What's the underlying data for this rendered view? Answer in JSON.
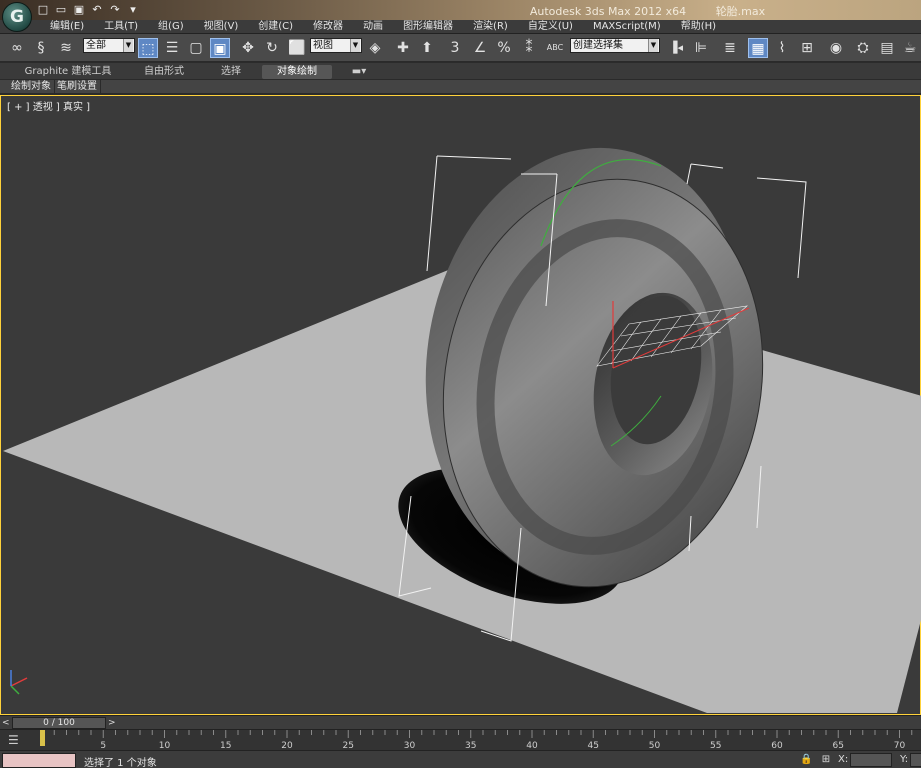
{
  "window": {
    "app_title": "Autodesk 3ds Max  2012 x64",
    "file_name": "轮胎.max",
    "logo_glyph": "G"
  },
  "quick_access": {
    "icons": [
      "new-file-icon",
      "open-file-icon",
      "save-icon",
      "undo-icon",
      "redo-icon",
      "customize-icon"
    ],
    "glyphs": [
      "□",
      "▭",
      "▣",
      "↶",
      "↷",
      "▾"
    ]
  },
  "menus": [
    "编辑(E)",
    "工具(T)",
    "组(G)",
    "视图(V)",
    "创建(C)",
    "修改器",
    "动画",
    "图形编辑器",
    "渲染(R)",
    "自定义(U)",
    "MAXScript(M)",
    "帮助(H)"
  ],
  "toolbar": {
    "selection_filter": "全部",
    "reference_coord": "视图",
    "named_selection": "创建选择集",
    "snap_3": "3",
    "snap_percent": "%",
    "glyphs": {
      "link": "∞",
      "unlink": "§",
      "bind": "≋",
      "select": "⬚",
      "select_name": "☰",
      "rect_region": "▢",
      "window_crossing": "▣",
      "move": "✥",
      "rotate": "↻",
      "scale": "⬜",
      "pivot": "◈",
      "manipulate": "✚",
      "keyboard_shortcut": "⬆",
      "angle_snap": "∠",
      "spinner_snap": "⁑",
      "edit_named": "ABC",
      "mirror": "▐◂",
      "align": "⊫",
      "layers": "≣",
      "graphite": "▦",
      "curve_editor": "⌇",
      "schematic": "⊞",
      "material_editor": "◉",
      "render_setup": "⛭",
      "rendered_frame": "▤",
      "render": "☕"
    }
  },
  "ribbon": {
    "tabs": [
      "Graphite 建模工具",
      "自由形式",
      "选择",
      "对象绘制"
    ],
    "active_tab": 3,
    "dropdown_glyph": "▬▾",
    "sub_panels": [
      "绘制对象",
      "笔刷设置"
    ]
  },
  "viewport": {
    "label": "[ + ] 透视 ] 真实 ]"
  },
  "time_slider": {
    "position": "0 / 100",
    "prev": "<",
    "next": ">"
  },
  "trackbar": {
    "icon_glyph": "☰",
    "ticks": [
      "5",
      "10",
      "15",
      "20",
      "25",
      "30",
      "35",
      "40",
      "45",
      "50",
      "55",
      "60",
      "65",
      "70"
    ]
  },
  "statusbar": {
    "message": "选择了 1 个对象",
    "lock_glyph": "🔒",
    "abs_glyph": "⊞",
    "x_label": "X:",
    "y_label": "Y:"
  },
  "colors": {
    "viewport_bg": "#3a3a3a",
    "viewport_border": "#ffd23a",
    "ground": "#b7b7b7",
    "tire": "#5a5a5a",
    "active_tool": "#5f88c4"
  }
}
